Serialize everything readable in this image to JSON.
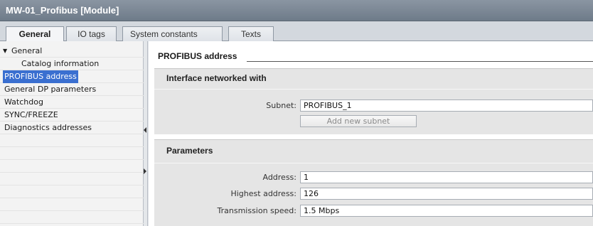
{
  "window": {
    "title": "MW-01_Profibus [Module]"
  },
  "tabs": [
    {
      "label": "General",
      "active": true
    },
    {
      "label": "IO tags",
      "active": false
    },
    {
      "label": "System constants",
      "active": false
    },
    {
      "label": "Texts",
      "active": false
    }
  ],
  "sidebar": {
    "items": [
      {
        "label": "General",
        "expanded": true
      },
      {
        "label": "Catalog information"
      },
      {
        "label": "PROFIBUS address",
        "selected": true
      },
      {
        "label": "General DP parameters"
      },
      {
        "label": "Watchdog"
      },
      {
        "label": "SYNC/FREEZE"
      },
      {
        "label": "Diagnostics addresses"
      }
    ]
  },
  "main": {
    "section_title": "PROFIBUS address",
    "interface": {
      "title": "Interface networked with",
      "subnet_label": "Subnet:",
      "subnet_value": "PROFIBUS_1",
      "add_subnet_button": "Add new subnet"
    },
    "parameters": {
      "title": "Parameters",
      "address_label": "Address:",
      "address_value": "1",
      "highest_label": "Highest address:",
      "highest_value": "126",
      "speed_label": "Transmission speed:",
      "speed_value": "1.5 Mbps"
    }
  },
  "colors": {
    "selection": "#3a6fd0",
    "titlebar": "#7b8794",
    "panel": "#e5e5e5"
  }
}
